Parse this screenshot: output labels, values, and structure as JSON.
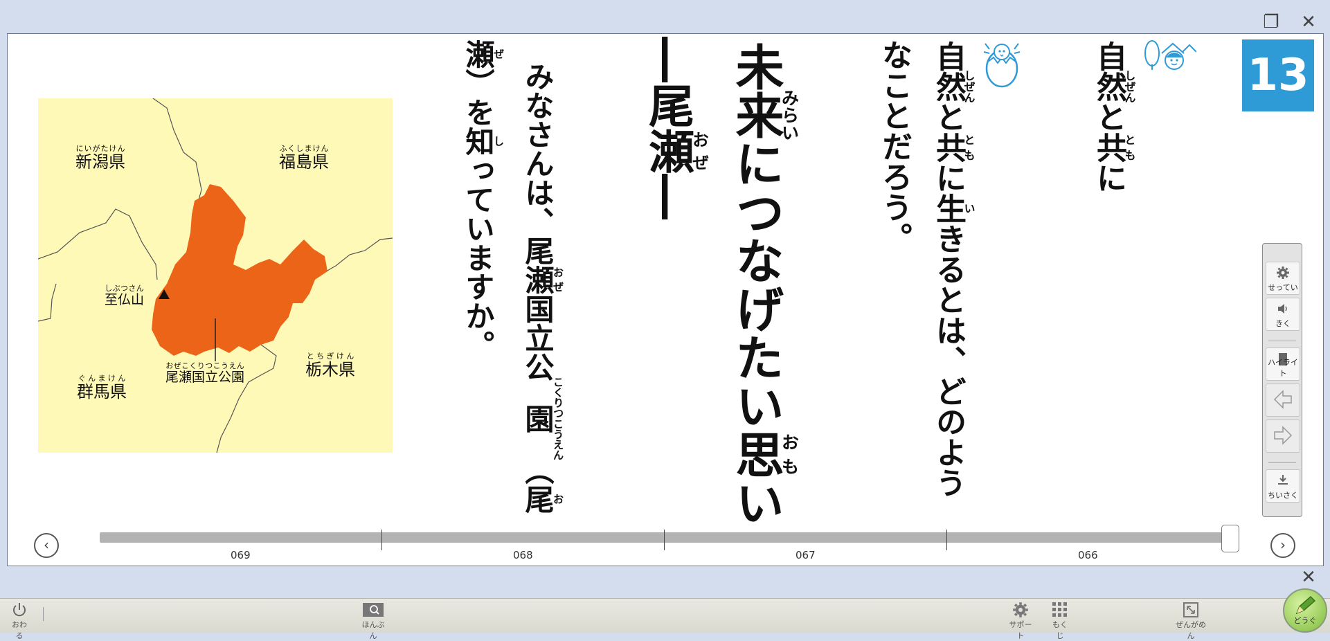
{
  "window": {
    "restore_symbol": "❐",
    "close_symbol": "✕"
  },
  "page": {
    "number": "13"
  },
  "text_columns": {
    "header_title": [
      {
        "base": "自",
        "rt": ""
      },
      {
        "base": "然",
        "rt": "しぜん"
      },
      {
        "base": "と",
        "rt": ""
      },
      {
        "base": "共",
        "rt": "とも"
      },
      {
        "base": "に",
        "rt": ""
      }
    ],
    "question_line1": [
      {
        "base": "自",
        "rt": ""
      },
      {
        "base": "然",
        "rt": "しぜん"
      },
      {
        "base": "と",
        "rt": ""
      },
      {
        "base": "共",
        "rt": "とも"
      },
      {
        "base": "に",
        "rt": ""
      },
      {
        "base": "生",
        "rt": "い"
      },
      {
        "base": "きるとは、どのよう",
        "rt": ""
      }
    ],
    "question_line2": [
      {
        "base": "なことだろう。",
        "rt": ""
      }
    ],
    "chapter_title": [
      {
        "base": "未",
        "rt": ""
      },
      {
        "base": "来",
        "rt": "みらい"
      },
      {
        "base": "につなげたい",
        "rt": ""
      },
      {
        "base": "思",
        "rt": "おも"
      },
      {
        "base": "い",
        "rt": ""
      }
    ],
    "chapter_subtitle": [
      {
        "base": "―",
        "rt": ""
      },
      {
        "base": "尾",
        "rt": ""
      },
      {
        "base": "瀬",
        "rt": "おぜ"
      },
      {
        "base": "―",
        "rt": ""
      }
    ],
    "body_line1": [
      {
        "base": "みなさんは、",
        "rt": ""
      },
      {
        "base": "尾",
        "rt": ""
      },
      {
        "base": "瀬",
        "rt": "おぜ"
      },
      {
        "base": "国",
        "rt": ""
      },
      {
        "base": "立",
        "rt": ""
      },
      {
        "base": "公",
        "rt": ""
      },
      {
        "base": "園",
        "rt": "こくりつこうえん"
      },
      {
        "base": "（",
        "rt": ""
      },
      {
        "base": "尾",
        "rt": "お"
      }
    ],
    "body_line2": [
      {
        "base": "瀬",
        "rt": "ぜ"
      },
      {
        "base": "）を",
        "rt": ""
      },
      {
        "base": "知",
        "rt": "し"
      },
      {
        "base": "っていますか。",
        "rt": ""
      }
    ]
  },
  "map": {
    "labels": {
      "niigata": {
        "text": "新潟県",
        "ruby": "にいがたけん"
      },
      "fukushima": {
        "text": "福島県",
        "ruby": "ふくしまけん"
      },
      "shibutsu": {
        "text": "至仏山",
        "ruby": "しぶつさん"
      },
      "oze_park": {
        "text": "尾瀬国立公園",
        "ruby": "おぜこくりつこうえん"
      },
      "gunma": {
        "text": "群馬県",
        "ruby": "ぐんまけん"
      },
      "tochigi": {
        "text": "栃木県",
        "ruby": "とちぎけん"
      }
    },
    "colors": {
      "background": "#fff9b8",
      "park": "#ec6417",
      "border": "#555555"
    }
  },
  "tools": {
    "settings": "せってい",
    "listen": "きく",
    "highlight": "ハイライト",
    "shrink": "ちいさく"
  },
  "slider": {
    "ticks": [
      "069",
      "068",
      "067",
      "066"
    ]
  },
  "bottom_bar": {
    "quit": "おわる",
    "honbun": "ほんぶん",
    "support": "サポート",
    "mokuji": "もくじ",
    "zengamen": "ぜんがめん",
    "dougu": "どうぐ"
  }
}
